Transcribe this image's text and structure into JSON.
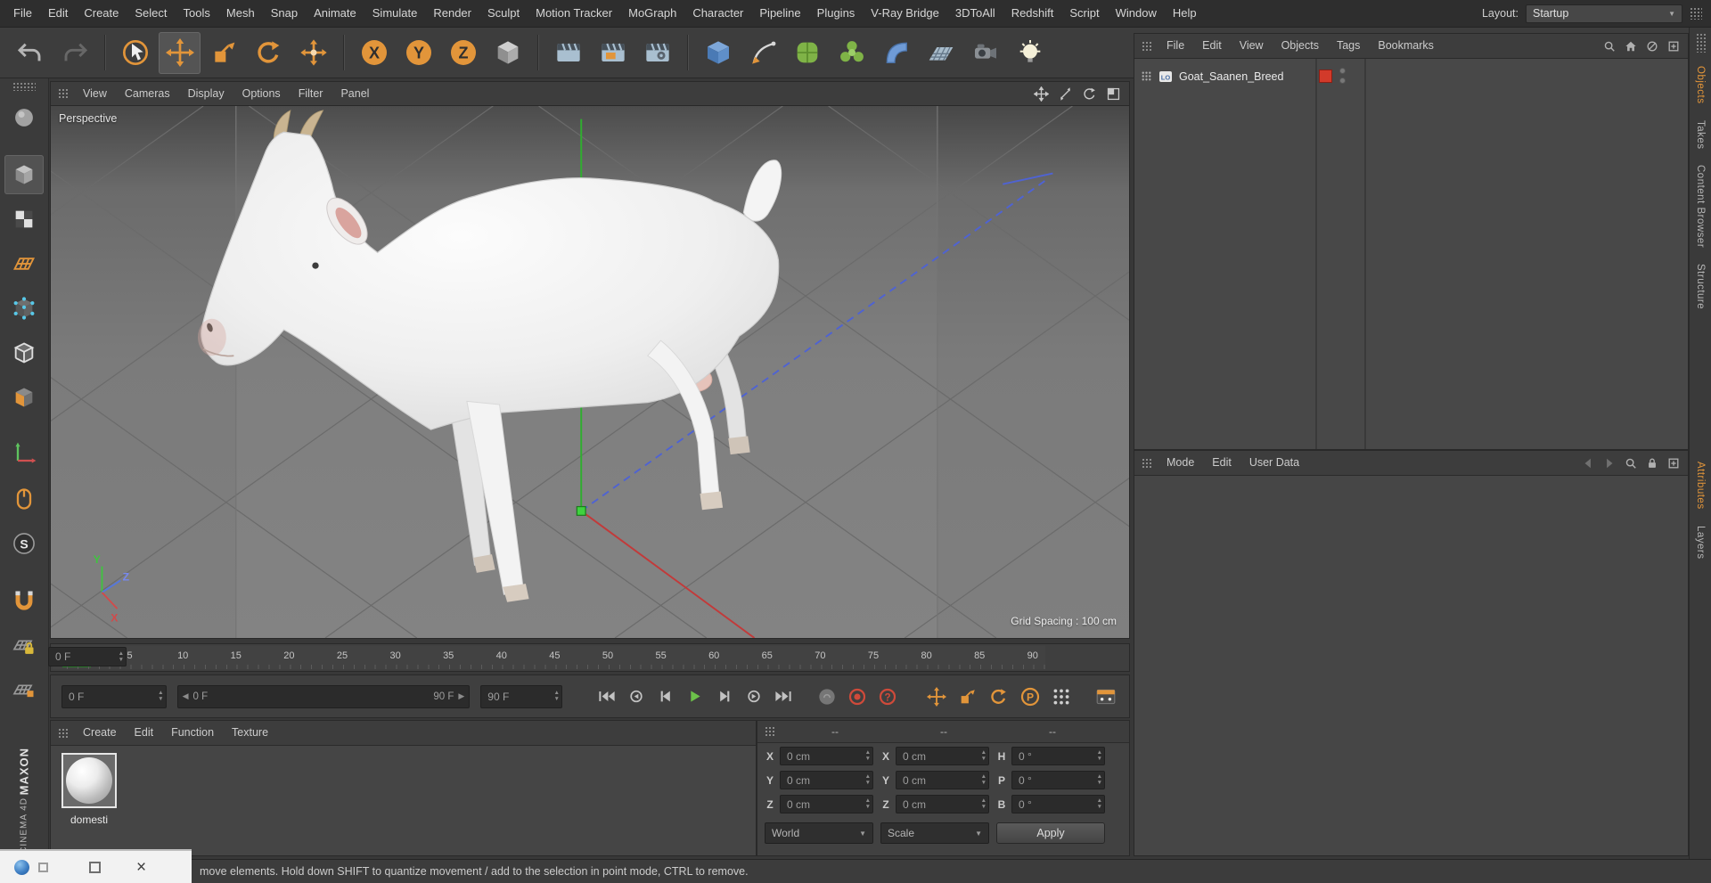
{
  "menubar": {
    "items": [
      "File",
      "Edit",
      "Create",
      "Select",
      "Tools",
      "Mesh",
      "Snap",
      "Animate",
      "Simulate",
      "Render",
      "Sculpt",
      "Motion Tracker",
      "MoGraph",
      "Character",
      "Pipeline",
      "Plugins",
      "V-Ray Bridge",
      "3DToAll",
      "Redshift",
      "Script",
      "Window",
      "Help"
    ],
    "layout_label": "Layout:",
    "layout_value": "Startup"
  },
  "toolbar": {
    "buttons": [
      "undo",
      "redo",
      "sep",
      "live-selection",
      "move",
      "scale",
      "rotate",
      "move-axis",
      "sep",
      "axis-x",
      "axis-y",
      "axis-z",
      "coordinate-system",
      "sep",
      "render-view",
      "render-picture-viewer",
      "edit-render-settings",
      "sep",
      "add-cube",
      "pen-spline",
      "subdivision-surface",
      "mograph",
      "deformer",
      "floor",
      "camera",
      "light"
    ],
    "active_tool": "move",
    "axis_labels": [
      "X",
      "Y",
      "Z"
    ]
  },
  "sidebar": {
    "tools": [
      {
        "name": "convert"
      },
      {
        "name": "model-mode",
        "gap": true,
        "active": true
      },
      {
        "name": "texture-mode"
      },
      {
        "name": "workplane"
      },
      {
        "name": "points-mode"
      },
      {
        "name": "edges-mode"
      },
      {
        "name": "polygons-mode"
      },
      {
        "name": "enable-axis",
        "gap": true
      },
      {
        "name": "mouse-input"
      },
      {
        "name": "snap"
      },
      {
        "name": "magnet-snap",
        "gap": true
      },
      {
        "name": "workplane-lock"
      },
      {
        "name": "workplane-grid"
      }
    ]
  },
  "viewport": {
    "menus": [
      "View",
      "Cameras",
      "Display",
      "Options",
      "Filter",
      "Panel"
    ],
    "nav_icons": [
      "pan-view",
      "zoom-view",
      "rotate-view",
      "toggle-view"
    ],
    "camera_label": "Perspective",
    "grid_spacing_label": "Grid Spacing : 100 cm",
    "axis_labels": {
      "x": "X",
      "y": "Y",
      "z": "Z"
    }
  },
  "object_manager": {
    "menus": [
      "File",
      "Edit",
      "View",
      "Objects",
      "Tags",
      "Bookmarks"
    ],
    "header_icons": [
      "search",
      "home",
      "link",
      "panel-new"
    ],
    "objects": [
      {
        "name": "Goat_Saanen_Breed"
      }
    ]
  },
  "attribute_manager": {
    "menus": [
      "Mode",
      "Edit",
      "User Data"
    ],
    "header_icons": [
      "nav-back",
      "nav-forward",
      "search",
      "lock",
      "panel-new"
    ]
  },
  "timeline": {
    "ticks": [
      "0",
      "5",
      "10",
      "15",
      "20",
      "25",
      "30",
      "35",
      "40",
      "45",
      "50",
      "55",
      "60",
      "65",
      "70",
      "75",
      "80",
      "85",
      "90"
    ],
    "frame_field": "0 F",
    "current_frame": "0 F",
    "range_start": "0 F",
    "range_end": "90 F",
    "end_frame": "90 F"
  },
  "playback": {
    "transport": [
      "goto-start",
      "previous-key",
      "previous-frame",
      "play",
      "next-frame",
      "next-key",
      "goto-end"
    ],
    "record": [
      "play-sound",
      "record-objects",
      "autokey-question"
    ],
    "key_toggles": [
      "key-position",
      "key-scale",
      "key-rotation",
      "key-parameter",
      "key-point-level"
    ],
    "extra": [
      "keyframe-selection"
    ]
  },
  "material_manager": {
    "menus": [
      "Create",
      "Edit",
      "Function",
      "Texture"
    ],
    "materials": [
      {
        "name": "domesti"
      }
    ]
  },
  "coordinates": {
    "headers": [
      "--",
      "--",
      "--"
    ],
    "rows": [
      {
        "cells": [
          {
            "label": "X",
            "value": "0 cm"
          },
          {
            "label": "X",
            "value": "0 cm"
          },
          {
            "label": "H",
            "value": "0 °"
          }
        ]
      },
      {
        "cells": [
          {
            "label": "Y",
            "value": "0 cm"
          },
          {
            "label": "Y",
            "value": "0 cm"
          },
          {
            "label": "P",
            "value": "0 °"
          }
        ]
      },
      {
        "cells": [
          {
            "label": "Z",
            "value": "0 cm"
          },
          {
            "label": "Z",
            "value": "0 cm"
          },
          {
            "label": "B",
            "value": "0 °"
          }
        ]
      }
    ],
    "selects": [
      "World",
      "Scale"
    ],
    "apply_label": "Apply"
  },
  "right_tabs": {
    "top": [
      {
        "label": "Objects",
        "active": true
      },
      {
        "label": "Takes",
        "active": false
      },
      {
        "label": "Content Browser",
        "active": false
      },
      {
        "label": "Structure",
        "active": false
      }
    ],
    "bottom": [
      {
        "label": "Attributes",
        "active": true
      },
      {
        "label": "Layers",
        "active": false
      }
    ]
  },
  "status_bar": {
    "text": "move elements. Hold down SHIFT to quantize movement / add to the selection in point mode, CTRL to remove."
  },
  "brand": {
    "line1": "MAXON",
    "line2": "CINEMA 4D"
  },
  "colors": {
    "accent_orange": "#E2953A",
    "axis_green": "#2FAE2F",
    "axis_blue": "#4F63D2",
    "axis_red": "#C23A3A",
    "record_red": "#CF4A3A",
    "object_color_red": "#D23A2A",
    "play_green": "#6CC24A",
    "marker_green": "#49A33C"
  }
}
